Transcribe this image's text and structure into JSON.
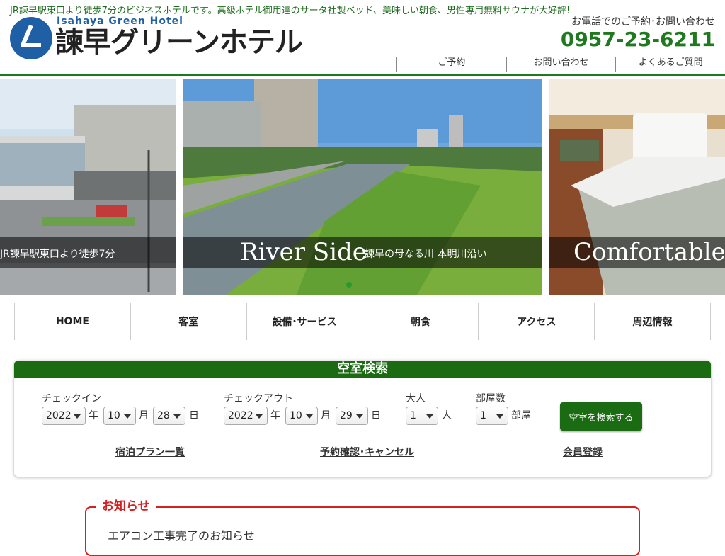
{
  "header": {
    "tagline": "JR諫早駅東口より徒歩7分のビジネスホテルです。高級ホテル御用達のサータ社製ベッド、美味しい朝食、男性専用無料サウナが大好評!",
    "logo_en": "Isahaya Green Hotel",
    "logo_jp": "諫早グリーンホテル",
    "contact_label": "お電話でのご予約･お問い合わせ",
    "phone": "0957-23-6211",
    "top_nav": [
      "ご予約",
      "お問い合わせ",
      "よくあるご質問"
    ]
  },
  "slider": {
    "slide1_caption": "JR諫早駅東口より徒歩7分",
    "slide2_caption_big": "River Side",
    "slide2_caption_small": "諫早の母なる川 本明川沿い",
    "slide3_caption_big": "Comfortable"
  },
  "main_nav": [
    "HOME",
    "客室",
    "設備･サービス",
    "朝食",
    "アクセス",
    "周辺情報"
  ],
  "search": {
    "title": "空室検索",
    "checkin_label": "チェックイン",
    "checkout_label": "チェックアウト",
    "adults_label": "大人",
    "rooms_label": "部屋数",
    "checkin": {
      "year": "2022",
      "month": "10",
      "day": "28"
    },
    "checkout": {
      "year": "2022",
      "month": "10",
      "day": "29"
    },
    "adults": "1",
    "rooms": "1",
    "unit_year": "年",
    "unit_month": "月",
    "unit_day": "日",
    "unit_person": "人",
    "unit_room": "部屋",
    "button": "空室を検索する",
    "links": [
      "宿泊プラン一覧",
      "予約確認･キャンセル",
      "会員登録"
    ]
  },
  "notice": {
    "title": "お知らせ",
    "items": [
      "エアコン工事完了のお知らせ"
    ]
  },
  "colors": {
    "brand_green": "#1a6b12",
    "accent_red": "#d42020",
    "logo_blue": "#1f5fa5"
  }
}
